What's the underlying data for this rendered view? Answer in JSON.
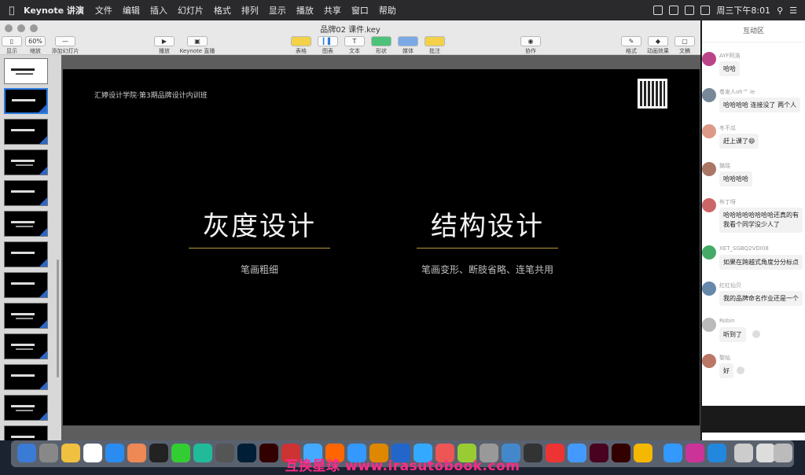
{
  "menubar": {
    "app": "Keynote 讲演",
    "items": [
      "文件",
      "编辑",
      "插入",
      "幻灯片",
      "格式",
      "排列",
      "显示",
      "播放",
      "共享",
      "窗口",
      "帮助"
    ],
    "clock": "周三下午8:01"
  },
  "window": {
    "doc_title": "品牌02 课件.key",
    "toolbar_left": [
      {
        "icon": "display-icon",
        "label": "显示"
      },
      {
        "icon": "zoom-icon",
        "label": "缩放",
        "value": "60%"
      },
      {
        "icon": "add-slide-icon",
        "label": "添加幻灯片"
      }
    ],
    "toolbar_mid": [
      {
        "icon": "play-icon",
        "label": "播放"
      },
      {
        "icon": "live-icon",
        "label": "Keynote 直播"
      }
    ],
    "toolbar_insert": [
      {
        "icon": "table-icon",
        "label": "表格"
      },
      {
        "icon": "chart-icon",
        "label": "图表"
      },
      {
        "icon": "text-icon",
        "label": "文本"
      },
      {
        "icon": "shape-icon",
        "label": "形状"
      },
      {
        "icon": "media-icon",
        "label": "媒体"
      },
      {
        "icon": "comment-icon",
        "label": "批注"
      }
    ],
    "toolbar_collab": {
      "icon": "collab-icon",
      "label": "协作"
    },
    "toolbar_right": [
      {
        "icon": "format-icon",
        "label": "格式"
      },
      {
        "icon": "animate-icon",
        "label": "动画效果"
      },
      {
        "icon": "document-icon",
        "label": "文稿"
      }
    ]
  },
  "slide": {
    "header": "汇婷设计学院·第3期品牌设计内训班",
    "left_title": "灰度设计",
    "left_sub": "笔画粗细",
    "right_title": "结构设计",
    "right_sub": "笔画变形、断肢省略、连笔共用"
  },
  "chat": {
    "title": "互动区",
    "messages": [
      {
        "name": "AYF阿浩",
        "text": "哈哈"
      },
      {
        "name": "卷发人oh™ ie",
        "text": "哈哈哈哈 连接没了 两个人"
      },
      {
        "name": "冬不瓜",
        "text": "赶上课了😄"
      },
      {
        "name": "璐瑶",
        "text": "哈哈哈哈"
      },
      {
        "name": "布丁呀",
        "text": "哈哈哈哈哈哈哈哈还真的有\n我看个同学没少人了"
      },
      {
        "name": "XET_SGBQ2VDI08",
        "text": "如果在跨越式角度分分标点"
      },
      {
        "name": "红红仙贝",
        "text": "我的品牌命名作业还是一个"
      },
      {
        "name": "Robin",
        "text": "听到了"
      },
      {
        "name": "黎灿",
        "text": "好"
      }
    ]
  },
  "watermark": "互换星球 www.irasutobook.com"
}
